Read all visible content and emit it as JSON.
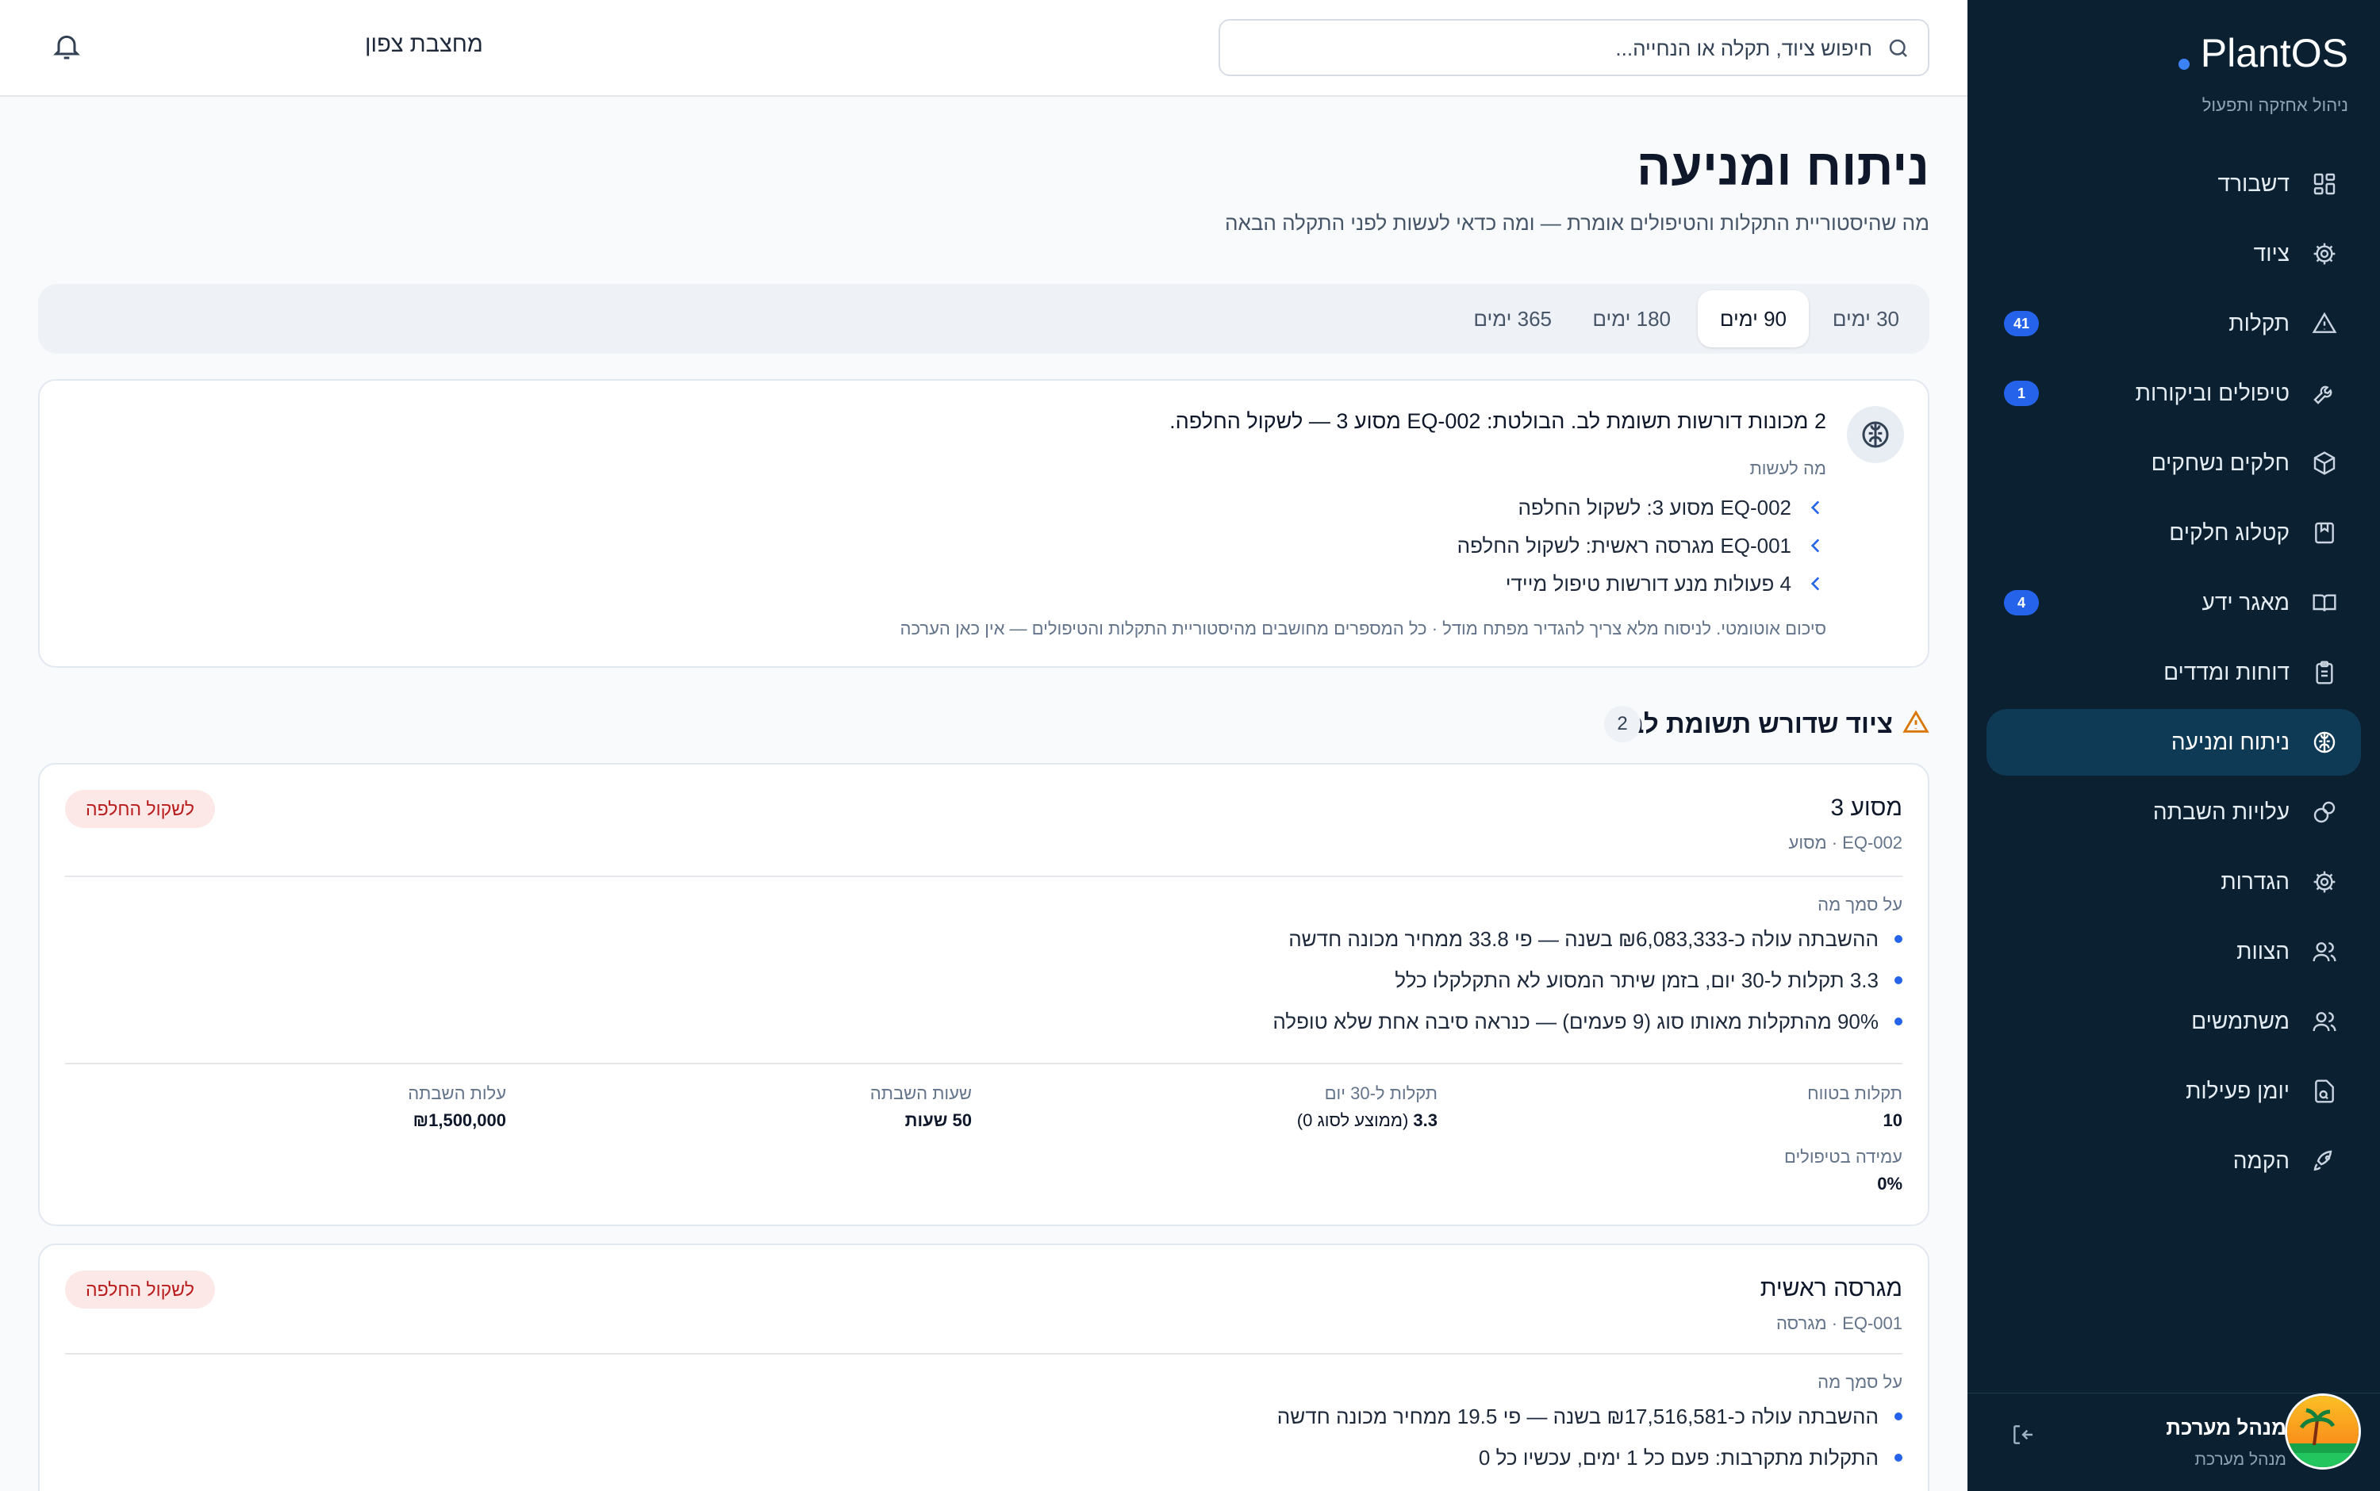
{
  "app": {
    "name": "PlantOS",
    "tagline": "ניהול אחזקה ותפעול"
  },
  "sidebar": {
    "items": [
      {
        "label": "דשבורד",
        "icon": "dashboard-icon",
        "badge": ""
      },
      {
        "label": "ציוד",
        "icon": "gear-icon",
        "badge": ""
      },
      {
        "label": "תקלות",
        "icon": "warning-icon",
        "badge": "41"
      },
      {
        "label": "טיפולים וביקורות",
        "icon": "wrench-icon",
        "badge": "1"
      },
      {
        "label": "חלקים נשחקים",
        "icon": "box-icon",
        "badge": ""
      },
      {
        "label": "קטלוג חלקים",
        "icon": "catalog-icon",
        "badge": ""
      },
      {
        "label": "מאגר ידע",
        "icon": "book-icon",
        "badge": "4"
      },
      {
        "label": "דוחות ומדדים",
        "icon": "clipboard-icon",
        "badge": ""
      },
      {
        "label": "ניתוח ומניעה",
        "icon": "brain-icon",
        "badge": "",
        "active": true
      },
      {
        "label": "עלויות השבתה",
        "icon": "coins-icon",
        "badge": ""
      },
      {
        "label": "הגדרות",
        "icon": "settings-icon",
        "badge": ""
      },
      {
        "label": "הצוות",
        "icon": "user-icon",
        "badge": ""
      },
      {
        "label": "משתמשים",
        "icon": "users-icon",
        "badge": ""
      },
      {
        "label": "יומן פעילות",
        "icon": "activity-log-icon",
        "badge": ""
      },
      {
        "label": "הקמה",
        "icon": "rocket-icon",
        "badge": ""
      }
    ],
    "user": {
      "name": "מנהל מערכת",
      "role": "מנהל מערכת"
    }
  },
  "topbar": {
    "search_placeholder": "חיפוש ציוד, תקלה או הנחייה...",
    "site_name": "מחצבת צפון"
  },
  "page": {
    "title": "ניתוח ומניעה",
    "subtitle": "מה שהיסטוריית התקלות והטיפולים אומרת — ומה כדאי לעשות לפני התקלה הבאה"
  },
  "tabs": [
    {
      "label": "30 ימים",
      "active": false
    },
    {
      "label": "90 ימים",
      "active": true
    },
    {
      "label": "180 ימים",
      "active": false
    },
    {
      "label": "365 ימים",
      "active": false
    }
  ],
  "summary": {
    "headline": "2 מכונות דורשות תשומת לב. הבולטת: EQ-002 מסוע 3 — לשקול החלפה.",
    "what_to_do_label": "מה לעשות",
    "actions": [
      "EQ-002 מסוע 3: לשקול החלפה",
      "EQ-001 מגרסה ראשית: לשקול החלפה",
      "4 פעולות מנע דורשות טיפול מיידי"
    ],
    "note": "סיכום אוטומטי. לניסוח מלא צריך להגדיר מפתח מודל · כל המספרים מחושבים מהיסטוריית התקלות והטיפולים — אין כאן הערכה"
  },
  "attention": {
    "title": "ציוד שדורש תשומת לב",
    "count": "2",
    "basis_label": "על סמך מה",
    "equipment": [
      {
        "name": "מסוע 3",
        "meta": "EQ-002 · מסוע",
        "tag": "לשקול החלפה",
        "reasons": [
          "ההשבתה עולה כ-₪6,083,333 בשנה — פי 33.8 ממחיר מכונה חדשה",
          "3.3 תקלות ל-30 יום, בזמן שיתר המסוע לא התקלקלו כלל",
          "90% מהתקלות מאותו סוג (9 פעמים) — כנראה סיבה אחת שלא טופלה"
        ],
        "stats": [
          {
            "label": "תקלות בטווח",
            "value": "10",
            "suffix": ""
          },
          {
            "label": "תקלות ל-30 יום",
            "value": "3.3",
            "suffix": " (ממוצע לסוג 0)"
          },
          {
            "label": "שעות השבתה",
            "value": "50 שעות",
            "suffix": ""
          },
          {
            "label": "עלות השבתה",
            "value": "₪1,500,000",
            "suffix": ""
          },
          {
            "label": "עמידה בטיפולים",
            "value": "0%",
            "suffix": ""
          }
        ]
      },
      {
        "name": "מגרסה ראשית",
        "meta": "EQ-001 · מגרסה",
        "tag": "לשקול החלפה",
        "reasons": [
          "ההשבתה עולה כ-₪17,516,581 בשנה — פי 19.5 ממחיר מכונה חדשה",
          "התקלות מתקרבות: פעם כל 1 ימים, עכשיו כל 0"
        ]
      }
    ]
  }
}
